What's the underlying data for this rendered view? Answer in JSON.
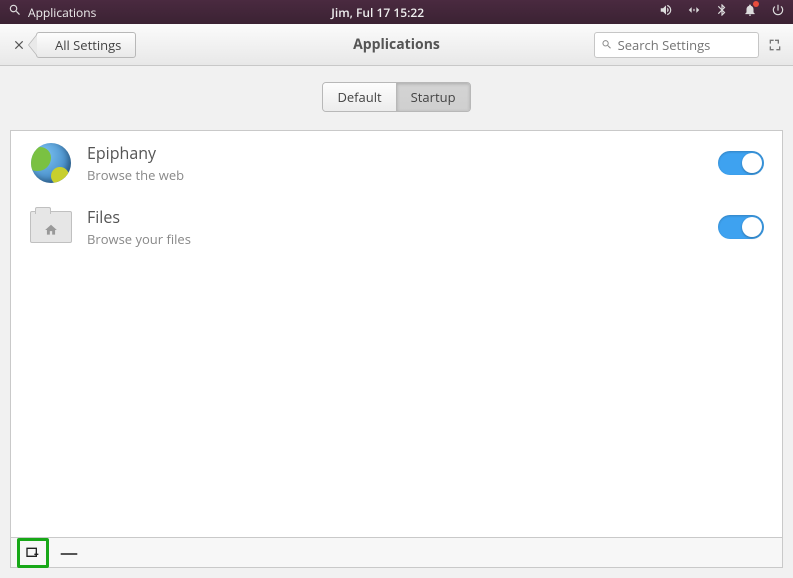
{
  "panel": {
    "app_label": "Applications",
    "clock": "Jim, Ful 17   15:22"
  },
  "winbar": {
    "back_label": "All Settings",
    "title": "Applications",
    "search_placeholder": "Search Settings"
  },
  "tabs": {
    "default": "Default",
    "startup": "Startup",
    "active": "startup"
  },
  "apps": [
    {
      "name": "Epiphany",
      "desc": "Browse the web",
      "enabled": true,
      "icon": "globe"
    },
    {
      "name": "Files",
      "desc": "Browse your files",
      "enabled": true,
      "icon": "folder"
    }
  ]
}
